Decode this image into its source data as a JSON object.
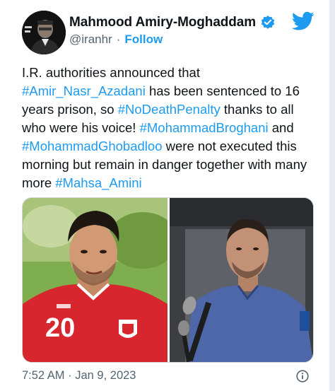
{
  "tweet": {
    "author_name": "Mahmood Amiry-Moghaddam",
    "handle": "@iranhr",
    "separator": "·",
    "follow_label": "Follow",
    "text_segments": [
      {
        "t": "I.R. authorities announced that ",
        "h": false
      },
      {
        "t": "#Amir_Nasr_Azadani",
        "h": true
      },
      {
        "t": " has been sentenced to 16 years prison, so ",
        "h": false
      },
      {
        "t": "#NoDeathPenalty",
        "h": true
      },
      {
        "t": " thanks to all who were his voice! ",
        "h": false
      },
      {
        "t": "#MohammadBroghani",
        "h": true
      },
      {
        "t": " and ",
        "h": false
      },
      {
        "t": "#MohammadGhobadloo",
        "h": true
      },
      {
        "t": " were not executed this morning but remain in danger together with many more ",
        "h": false
      },
      {
        "t": "#Mahsa_Amini",
        "h": true
      }
    ],
    "jersey_number": "20",
    "time": "7:52 AM",
    "date": "Jan 9, 2023",
    "footer_separator": "·"
  },
  "colors": {
    "link": "#1d9bf0",
    "muted": "#536471",
    "jersey_red": "#d7262d"
  }
}
